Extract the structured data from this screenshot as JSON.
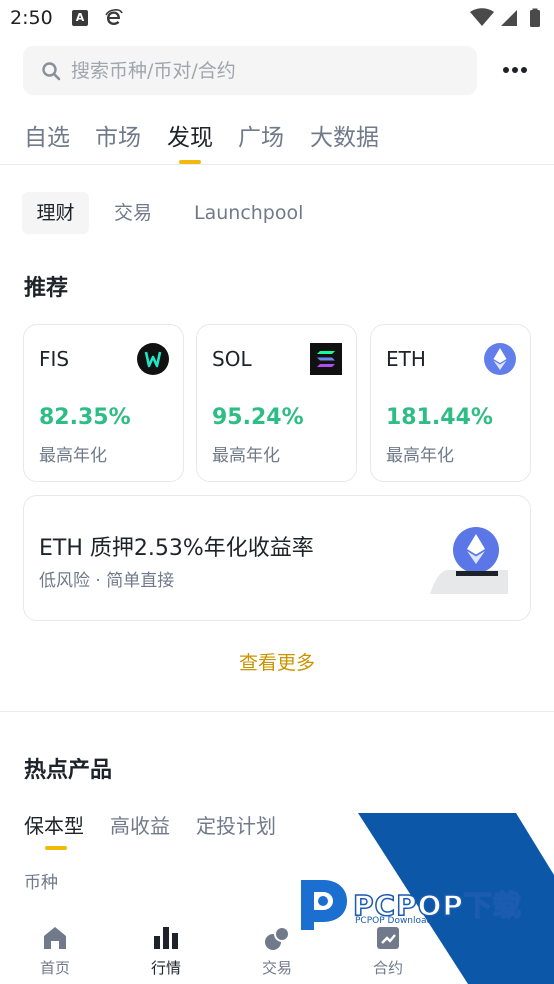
{
  "status_bar": {
    "time": "2:50",
    "notif_letter": "A"
  },
  "search": {
    "placeholder": "搜索币种/币对/合约"
  },
  "top_tabs": [
    "自选",
    "市场",
    "发现",
    "广场",
    "大数据"
  ],
  "sub_tabs": [
    "理财",
    "交易",
    "Launchpool"
  ],
  "recommend": {
    "title": "推荐",
    "cards": [
      {
        "symbol": "FIS",
        "rate": "82.35%",
        "label": "最高年化"
      },
      {
        "symbol": "SOL",
        "rate": "95.24%",
        "label": "最高年化"
      },
      {
        "symbol": "ETH",
        "rate": "181.44%",
        "label": "最高年化"
      }
    ],
    "wide_card": {
      "title": "ETH 质押2.53%年化收益率",
      "subtitle": "低风险 · 简单直接"
    },
    "see_more": "查看更多"
  },
  "hot": {
    "title": "热点产品",
    "tabs": [
      "保本型",
      "高收益",
      "定投计划"
    ],
    "column_header": "币种"
  },
  "bottom_nav": [
    "首页",
    "行情",
    "交易",
    "合约"
  ],
  "watermark": {
    "text": "PCPOP下载",
    "sub": "PCPOP Download"
  },
  "colors": {
    "accent": "#f0b90b",
    "positive": "#2ebd85",
    "link": "#c99400"
  }
}
